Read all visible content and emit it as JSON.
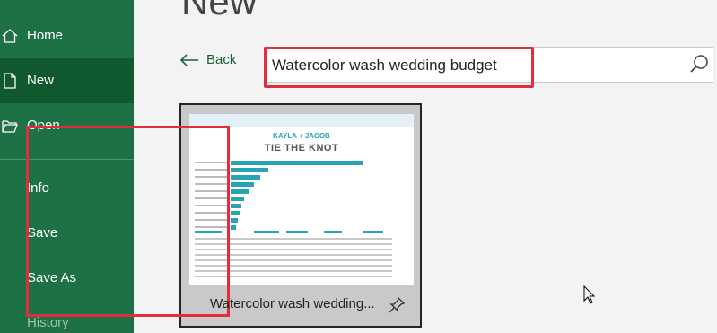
{
  "page": {
    "title": "New"
  },
  "sidebar": {
    "items": [
      {
        "label": "Home",
        "icon": "home-icon"
      },
      {
        "label": "New",
        "icon": "new-document-icon",
        "active": true
      },
      {
        "label": "Open",
        "icon": "open-folder-icon"
      },
      {
        "label": "Info"
      },
      {
        "label": "Save"
      },
      {
        "label": "Save As"
      },
      {
        "label": "History"
      }
    ]
  },
  "back": {
    "label": "Back",
    "icon": "back-arrow-icon"
  },
  "search": {
    "value": "Watercolor wash wedding budget",
    "icon": "search-icon"
  },
  "templates": [
    {
      "title": "Watercolor wash wedding...",
      "thumbnail": {
        "couple": "KAYLA + JACOB",
        "headline": "TIE THE KNOT"
      },
      "pin_icon": "pin-icon"
    }
  ],
  "colors": {
    "sidebar": "#1e7145",
    "sidebar_active": "#10592f",
    "accent_teal": "#27a3b5",
    "highlight_red": "#e22d3c",
    "background": "#f3f3f3"
  }
}
